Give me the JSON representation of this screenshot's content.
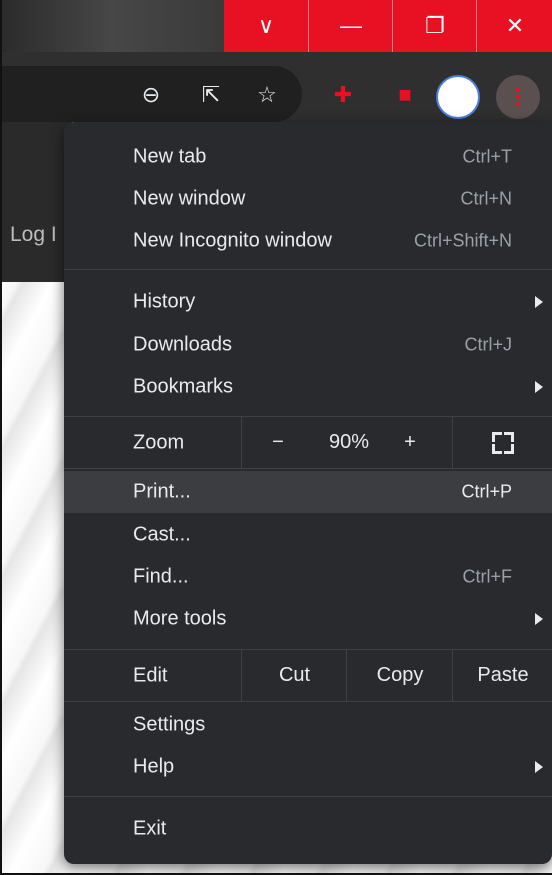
{
  "window_controls": {
    "dropdown_glyph": "∨",
    "minimize_glyph": "—",
    "restore_glyph": "❐",
    "close_glyph": "✕"
  },
  "toolbar": {
    "icons": [
      "zoom-out-icon",
      "share-icon",
      "bookmark-star-icon",
      "extension-pin-icon",
      "extension-square-icon",
      "profile-avatar",
      "menu-kebab-icon"
    ],
    "zoom_glyph": "⊖",
    "share_glyph": "⇱",
    "star_glyph": "☆",
    "pin_glyph": "✚",
    "square_glyph": "■"
  },
  "page": {
    "partial_text": "Log I"
  },
  "menu": {
    "new_tab": {
      "label": "New tab",
      "shortcut": "Ctrl+T"
    },
    "new_window": {
      "label": "New window",
      "shortcut": "Ctrl+N"
    },
    "new_incognito": {
      "label": "New Incognito window",
      "shortcut": "Ctrl+Shift+N"
    },
    "history": {
      "label": "History"
    },
    "downloads": {
      "label": "Downloads",
      "shortcut": "Ctrl+J"
    },
    "bookmarks": {
      "label": "Bookmarks"
    },
    "zoom": {
      "label": "Zoom",
      "minus": "−",
      "value": "90%",
      "plus": "+"
    },
    "print": {
      "label": "Print...",
      "shortcut": "Ctrl+P"
    },
    "cast": {
      "label": "Cast..."
    },
    "find": {
      "label": "Find...",
      "shortcut": "Ctrl+F"
    },
    "more_tools": {
      "label": "More tools"
    },
    "edit": {
      "label": "Edit",
      "cut": "Cut",
      "copy": "Copy",
      "paste": "Paste"
    },
    "settings": {
      "label": "Settings"
    },
    "help": {
      "label": "Help"
    },
    "exit": {
      "label": "Exit"
    }
  },
  "colors": {
    "accent_red": "#e81123",
    "menu_bg": "#292a2d",
    "menu_highlight": "#3c3d41",
    "menu_text": "#e8eaed",
    "shortcut_text": "#9aa0a6"
  }
}
